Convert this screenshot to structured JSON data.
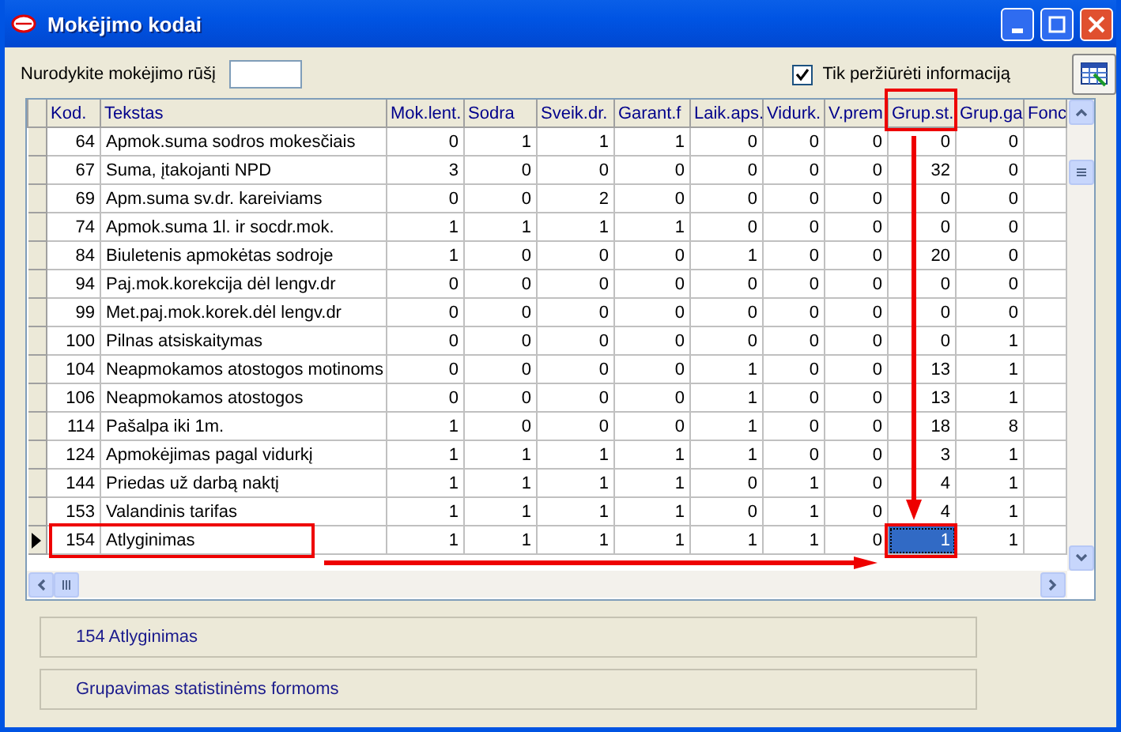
{
  "window": {
    "title": "Mokėjimo kodai"
  },
  "filter": {
    "label": "Nurodykite mokėjimo rūšį"
  },
  "view_only": {
    "label": "Tik peržiūrėti informaciją",
    "checked": true
  },
  "table": {
    "columns": [
      "Kod.",
      "Tekstas",
      "Mok.lent.",
      "Sodra",
      "Sveik.dr.",
      "Garant.f",
      "Laik.aps.",
      "Vidurk.",
      "V.prem",
      "Grup.st.",
      "Grup.ga",
      "Fonc"
    ],
    "rows": [
      {
        "cells": [
          {
            "text": "64",
            "selected": false
          },
          {
            "text": "Apmok.suma sodros mokesčiais",
            "selected": false
          },
          {
            "text": "0",
            "selected": false
          },
          {
            "text": "1",
            "selected": false
          },
          {
            "text": "1",
            "selected": false
          },
          {
            "text": "1",
            "selected": false
          },
          {
            "text": "0",
            "selected": false
          },
          {
            "text": "0",
            "selected": false
          },
          {
            "text": "0",
            "selected": false
          },
          {
            "text": "0",
            "selected": false
          },
          {
            "text": "0",
            "selected": false
          }
        ],
        "current": false
      },
      {
        "cells": [
          {
            "text": "67",
            "selected": false
          },
          {
            "text": "Suma, įtakojanti NPD",
            "selected": false
          },
          {
            "text": "3",
            "selected": false
          },
          {
            "text": "0",
            "selected": false
          },
          {
            "text": "0",
            "selected": false
          },
          {
            "text": "0",
            "selected": false
          },
          {
            "text": "0",
            "selected": false
          },
          {
            "text": "0",
            "selected": false
          },
          {
            "text": "0",
            "selected": false
          },
          {
            "text": "32",
            "selected": false
          },
          {
            "text": "0",
            "selected": false
          }
        ],
        "current": false
      },
      {
        "cells": [
          {
            "text": "69",
            "selected": false
          },
          {
            "text": "Apm.suma sv.dr. kareiviams",
            "selected": false
          },
          {
            "text": "0",
            "selected": false
          },
          {
            "text": "0",
            "selected": false
          },
          {
            "text": "2",
            "selected": false
          },
          {
            "text": "0",
            "selected": false
          },
          {
            "text": "0",
            "selected": false
          },
          {
            "text": "0",
            "selected": false
          },
          {
            "text": "0",
            "selected": false
          },
          {
            "text": "0",
            "selected": false
          },
          {
            "text": "0",
            "selected": false
          }
        ],
        "current": false
      },
      {
        "cells": [
          {
            "text": "74",
            "selected": false
          },
          {
            "text": "Apmok.suma 1l. ir socdr.mok.",
            "selected": false
          },
          {
            "text": "1",
            "selected": false
          },
          {
            "text": "1",
            "selected": false
          },
          {
            "text": "1",
            "selected": false
          },
          {
            "text": "1",
            "selected": false
          },
          {
            "text": "0",
            "selected": false
          },
          {
            "text": "0",
            "selected": false
          },
          {
            "text": "0",
            "selected": false
          },
          {
            "text": "0",
            "selected": false
          },
          {
            "text": "0",
            "selected": false
          }
        ],
        "current": false
      },
      {
        "cells": [
          {
            "text": "84",
            "selected": false
          },
          {
            "text": "Biuletenis apmokėtas sodroje",
            "selected": false
          },
          {
            "text": "1",
            "selected": false
          },
          {
            "text": "0",
            "selected": false
          },
          {
            "text": "0",
            "selected": false
          },
          {
            "text": "0",
            "selected": false
          },
          {
            "text": "1",
            "selected": false
          },
          {
            "text": "0",
            "selected": false
          },
          {
            "text": "0",
            "selected": false
          },
          {
            "text": "20",
            "selected": false
          },
          {
            "text": "0",
            "selected": false
          }
        ],
        "current": false
      },
      {
        "cells": [
          {
            "text": "94",
            "selected": false
          },
          {
            "text": "Paj.mok.korekcija dėl lengv.dr",
            "selected": false
          },
          {
            "text": "0",
            "selected": false
          },
          {
            "text": "0",
            "selected": false
          },
          {
            "text": "0",
            "selected": false
          },
          {
            "text": "0",
            "selected": false
          },
          {
            "text": "0",
            "selected": false
          },
          {
            "text": "0",
            "selected": false
          },
          {
            "text": "0",
            "selected": false
          },
          {
            "text": "0",
            "selected": false
          },
          {
            "text": "0",
            "selected": false
          }
        ],
        "current": false
      },
      {
        "cells": [
          {
            "text": "99",
            "selected": false
          },
          {
            "text": "Met.paj.mok.korek.dėl lengv.dr",
            "selected": false
          },
          {
            "text": "0",
            "selected": false
          },
          {
            "text": "0",
            "selected": false
          },
          {
            "text": "0",
            "selected": false
          },
          {
            "text": "0",
            "selected": false
          },
          {
            "text": "0",
            "selected": false
          },
          {
            "text": "0",
            "selected": false
          },
          {
            "text": "0",
            "selected": false
          },
          {
            "text": "0",
            "selected": false
          },
          {
            "text": "0",
            "selected": false
          }
        ],
        "current": false
      },
      {
        "cells": [
          {
            "text": "100",
            "selected": false
          },
          {
            "text": "Pilnas atsiskaitymas",
            "selected": false
          },
          {
            "text": "0",
            "selected": false
          },
          {
            "text": "0",
            "selected": false
          },
          {
            "text": "0",
            "selected": false
          },
          {
            "text": "0",
            "selected": false
          },
          {
            "text": "0",
            "selected": false
          },
          {
            "text": "0",
            "selected": false
          },
          {
            "text": "0",
            "selected": false
          },
          {
            "text": "0",
            "selected": false
          },
          {
            "text": "1",
            "selected": false
          }
        ],
        "current": false
      },
      {
        "cells": [
          {
            "text": "104",
            "selected": false
          },
          {
            "text": "Neapmokamos atostogos motinoms",
            "selected": false
          },
          {
            "text": "0",
            "selected": false
          },
          {
            "text": "0",
            "selected": false
          },
          {
            "text": "0",
            "selected": false
          },
          {
            "text": "0",
            "selected": false
          },
          {
            "text": "1",
            "selected": false
          },
          {
            "text": "0",
            "selected": false
          },
          {
            "text": "0",
            "selected": false
          },
          {
            "text": "13",
            "selected": false
          },
          {
            "text": "1",
            "selected": false
          }
        ],
        "current": false
      },
      {
        "cells": [
          {
            "text": "106",
            "selected": false
          },
          {
            "text": "Neapmokamos atostogos",
            "selected": false
          },
          {
            "text": "0",
            "selected": false
          },
          {
            "text": "0",
            "selected": false
          },
          {
            "text": "0",
            "selected": false
          },
          {
            "text": "0",
            "selected": false
          },
          {
            "text": "1",
            "selected": false
          },
          {
            "text": "0",
            "selected": false
          },
          {
            "text": "0",
            "selected": false
          },
          {
            "text": "13",
            "selected": false
          },
          {
            "text": "1",
            "selected": false
          }
        ],
        "current": false
      },
      {
        "cells": [
          {
            "text": "114",
            "selected": false
          },
          {
            "text": "Pašalpa iki 1m.",
            "selected": false
          },
          {
            "text": "1",
            "selected": false
          },
          {
            "text": "0",
            "selected": false
          },
          {
            "text": "0",
            "selected": false
          },
          {
            "text": "0",
            "selected": false
          },
          {
            "text": "1",
            "selected": false
          },
          {
            "text": "0",
            "selected": false
          },
          {
            "text": "0",
            "selected": false
          },
          {
            "text": "18",
            "selected": false
          },
          {
            "text": "8",
            "selected": false
          }
        ],
        "current": false
      },
      {
        "cells": [
          {
            "text": "124",
            "selected": false
          },
          {
            "text": "Apmokėjimas pagal vidurkį",
            "selected": false
          },
          {
            "text": "1",
            "selected": false
          },
          {
            "text": "1",
            "selected": false
          },
          {
            "text": "1",
            "selected": false
          },
          {
            "text": "1",
            "selected": false
          },
          {
            "text": "1",
            "selected": false
          },
          {
            "text": "0",
            "selected": false
          },
          {
            "text": "0",
            "selected": false
          },
          {
            "text": "3",
            "selected": false
          },
          {
            "text": "1",
            "selected": false
          }
        ],
        "current": false
      },
      {
        "cells": [
          {
            "text": "144",
            "selected": false
          },
          {
            "text": "Priedas už darbą naktį",
            "selected": false
          },
          {
            "text": "1",
            "selected": false
          },
          {
            "text": "1",
            "selected": false
          },
          {
            "text": "1",
            "selected": false
          },
          {
            "text": "1",
            "selected": false
          },
          {
            "text": "0",
            "selected": false
          },
          {
            "text": "1",
            "selected": false
          },
          {
            "text": "0",
            "selected": false
          },
          {
            "text": "4",
            "selected": false
          },
          {
            "text": "1",
            "selected": false
          }
        ],
        "current": false
      },
      {
        "cells": [
          {
            "text": "153",
            "selected": false
          },
          {
            "text": "Valandinis tarifas",
            "selected": false
          },
          {
            "text": "1",
            "selected": false
          },
          {
            "text": "1",
            "selected": false
          },
          {
            "text": "1",
            "selected": false
          },
          {
            "text": "1",
            "selected": false
          },
          {
            "text": "0",
            "selected": false
          },
          {
            "text": "1",
            "selected": false
          },
          {
            "text": "0",
            "selected": false
          },
          {
            "text": "4",
            "selected": false
          },
          {
            "text": "1",
            "selected": false
          }
        ],
        "current": false
      },
      {
        "cells": [
          {
            "text": "154",
            "selected": false
          },
          {
            "text": "Atlyginimas",
            "selected": false
          },
          {
            "text": "1",
            "selected": false
          },
          {
            "text": "1",
            "selected": false
          },
          {
            "text": "1",
            "selected": false
          },
          {
            "text": "1",
            "selected": false
          },
          {
            "text": "1",
            "selected": false
          },
          {
            "text": "1",
            "selected": false
          },
          {
            "text": "0",
            "selected": false
          },
          {
            "text": "1",
            "selected": true
          },
          {
            "text": "1",
            "selected": false
          }
        ],
        "current": true
      }
    ]
  },
  "status_panels": [
    "154 Atlyginimas",
    "Grupavimas statistinėms formoms"
  ]
}
